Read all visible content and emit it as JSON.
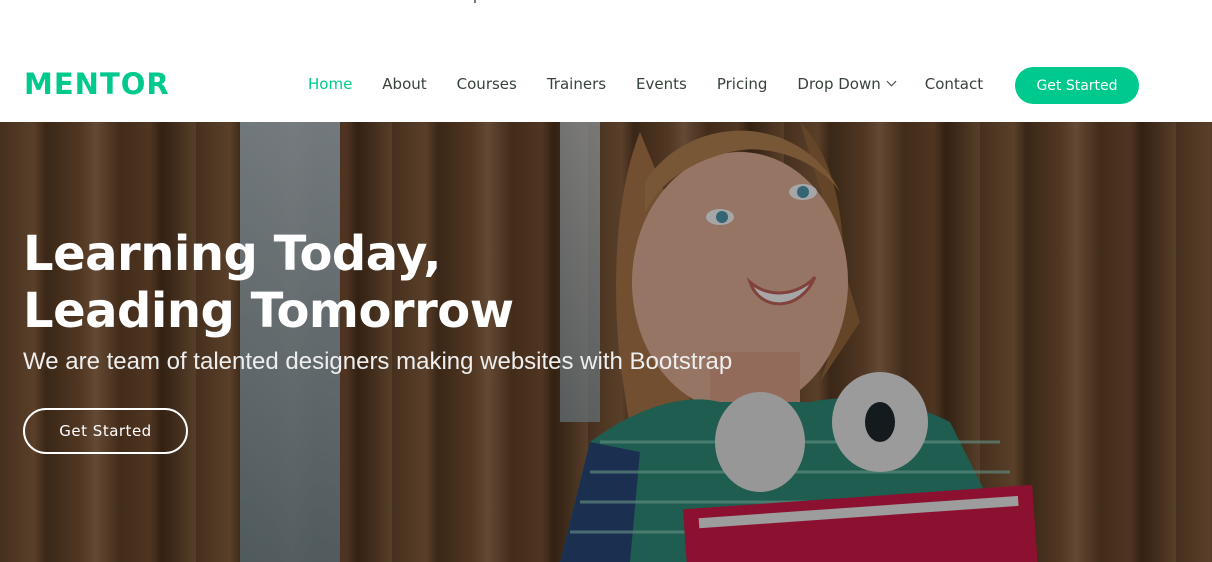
{
  "brand": {
    "logo_text": "MENTOR",
    "accent_color": "#00c98d"
  },
  "nav": {
    "items": [
      {
        "label": "Home",
        "active": true
      },
      {
        "label": "About"
      },
      {
        "label": "Courses"
      },
      {
        "label": "Trainers"
      },
      {
        "label": "Events"
      },
      {
        "label": "Pricing"
      },
      {
        "label": "Drop Down",
        "icon": "chevron-down-icon"
      },
      {
        "label": "Contact"
      }
    ],
    "cta_label": "Get Started"
  },
  "hero": {
    "title_line1": "Learning Today,",
    "title_line2": "Leading Tomorrow",
    "subtitle": "We are team of talented designers making websites with Bootstrap",
    "cta_label": "Get Started"
  }
}
